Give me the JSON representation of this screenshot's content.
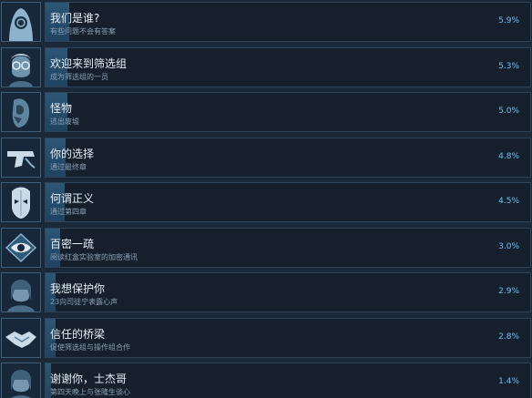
{
  "colors": {
    "accent": "#66c0f4",
    "background": "#1b2838",
    "progress_fill": "#2d5675"
  },
  "achievements": [
    {
      "icon": "hooded-person-icon",
      "title": "我们是谁?",
      "desc": "有些问题不会有答案",
      "percent": "5.9%",
      "fill_fraction": 0.048
    },
    {
      "icon": "glasses-man-icon",
      "title": "欢迎来到筛选组",
      "desc": "成为筛选组的一员",
      "percent": "5.3%",
      "fill_fraction": 0.045
    },
    {
      "icon": "monster-head-icon",
      "title": "怪物",
      "desc": "逃出废墟",
      "percent": "5.0%",
      "fill_fraction": 0.045
    },
    {
      "icon": "pistol-icon",
      "title": "你的选择",
      "desc": "通过最终章",
      "percent": "4.8%",
      "fill_fraction": 0.042
    },
    {
      "icon": "mask-icon",
      "title": "何谓正义",
      "desc": "通过第四章",
      "percent": "4.5%",
      "fill_fraction": 0.04
    },
    {
      "icon": "eye-diamond-icon",
      "title": "百密一疏",
      "desc": "阅读红盒实验室的加密通讯",
      "percent": "3.0%",
      "fill_fraction": 0.03
    },
    {
      "icon": "portrait-icon",
      "title": "我想保护你",
      "desc": "23向司徒宁表露心声",
      "percent": "2.9%",
      "fill_fraction": 0.02
    },
    {
      "icon": "handshake-icon",
      "title": "信任的桥梁",
      "desc": "促使筛选组与操作组合作",
      "percent": "2.8%",
      "fill_fraction": 0.02
    },
    {
      "icon": "portrait-icon",
      "title": "谢谢你，士杰哥",
      "desc": "第四天晚上与张隆生谈心",
      "percent": "1.4%",
      "fill_fraction": 0.012
    }
  ]
}
